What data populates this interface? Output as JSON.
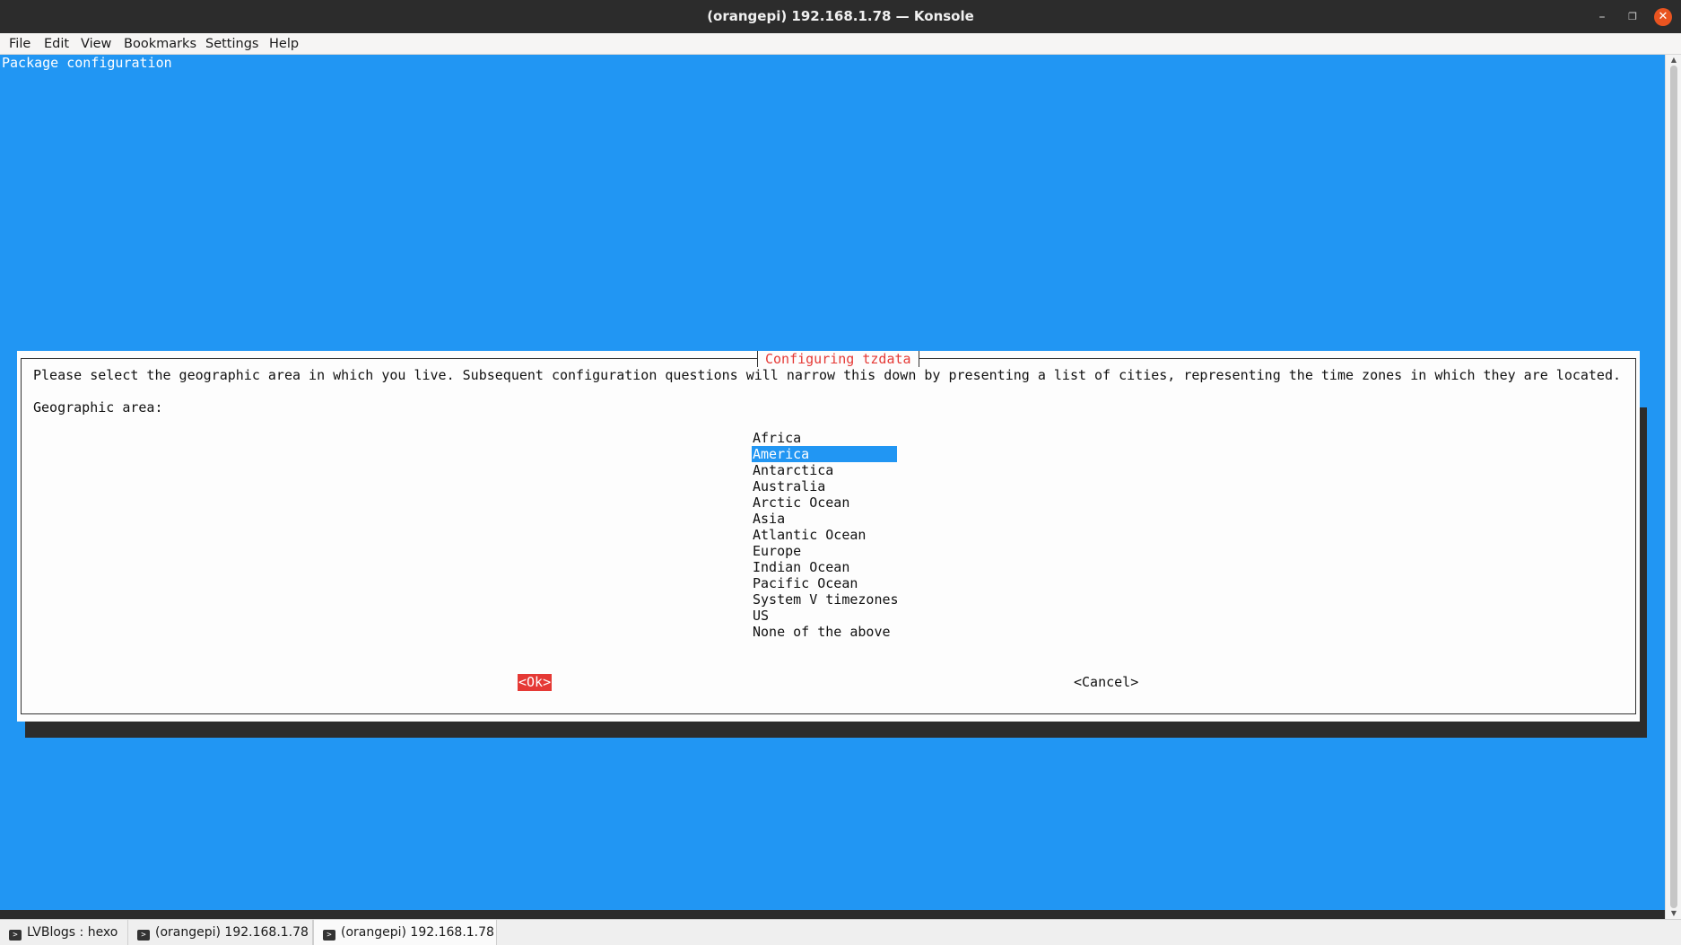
{
  "window": {
    "title": "(orangepi) 192.168.1.78 — Konsole",
    "minimize_glyph": "–",
    "maximize_glyph": "❐",
    "close_glyph": "✕"
  },
  "menubar": {
    "items": [
      "File",
      "Edit",
      "View",
      "Bookmarks",
      "Settings",
      "Help"
    ]
  },
  "terminal": {
    "header": "Package configuration",
    "dialog": {
      "title": "Configuring tzdata",
      "prompt": "Please select the geographic area in which you live. Subsequent configuration questions will narrow this down by presenting a list of cities, representing the time zones in which they are located.",
      "label": "Geographic area:",
      "areas": [
        "Africa",
        "America",
        "Antarctica",
        "Australia",
        "Arctic Ocean",
        "Asia",
        "Atlantic Ocean",
        "Europe",
        "Indian Ocean",
        "Pacific Ocean",
        "System V timezones",
        "US",
        "None of the above"
      ],
      "selected_area": "America",
      "ok_label": "<Ok>",
      "cancel_label": "<Cancel>"
    }
  },
  "tabs": [
    {
      "label": "LVBlogs : hexo",
      "active": false
    },
    {
      "label": "(orangepi) 192.168.1.78",
      "active": false
    },
    {
      "label": "(orangepi) 192.168.1.78",
      "active": true
    }
  ],
  "colors": {
    "terminal_bg": "#2196f3",
    "dialog_bg": "#fdfdfd",
    "accent_red": "#e53935",
    "titlebar_bg": "#2c2c2c"
  }
}
